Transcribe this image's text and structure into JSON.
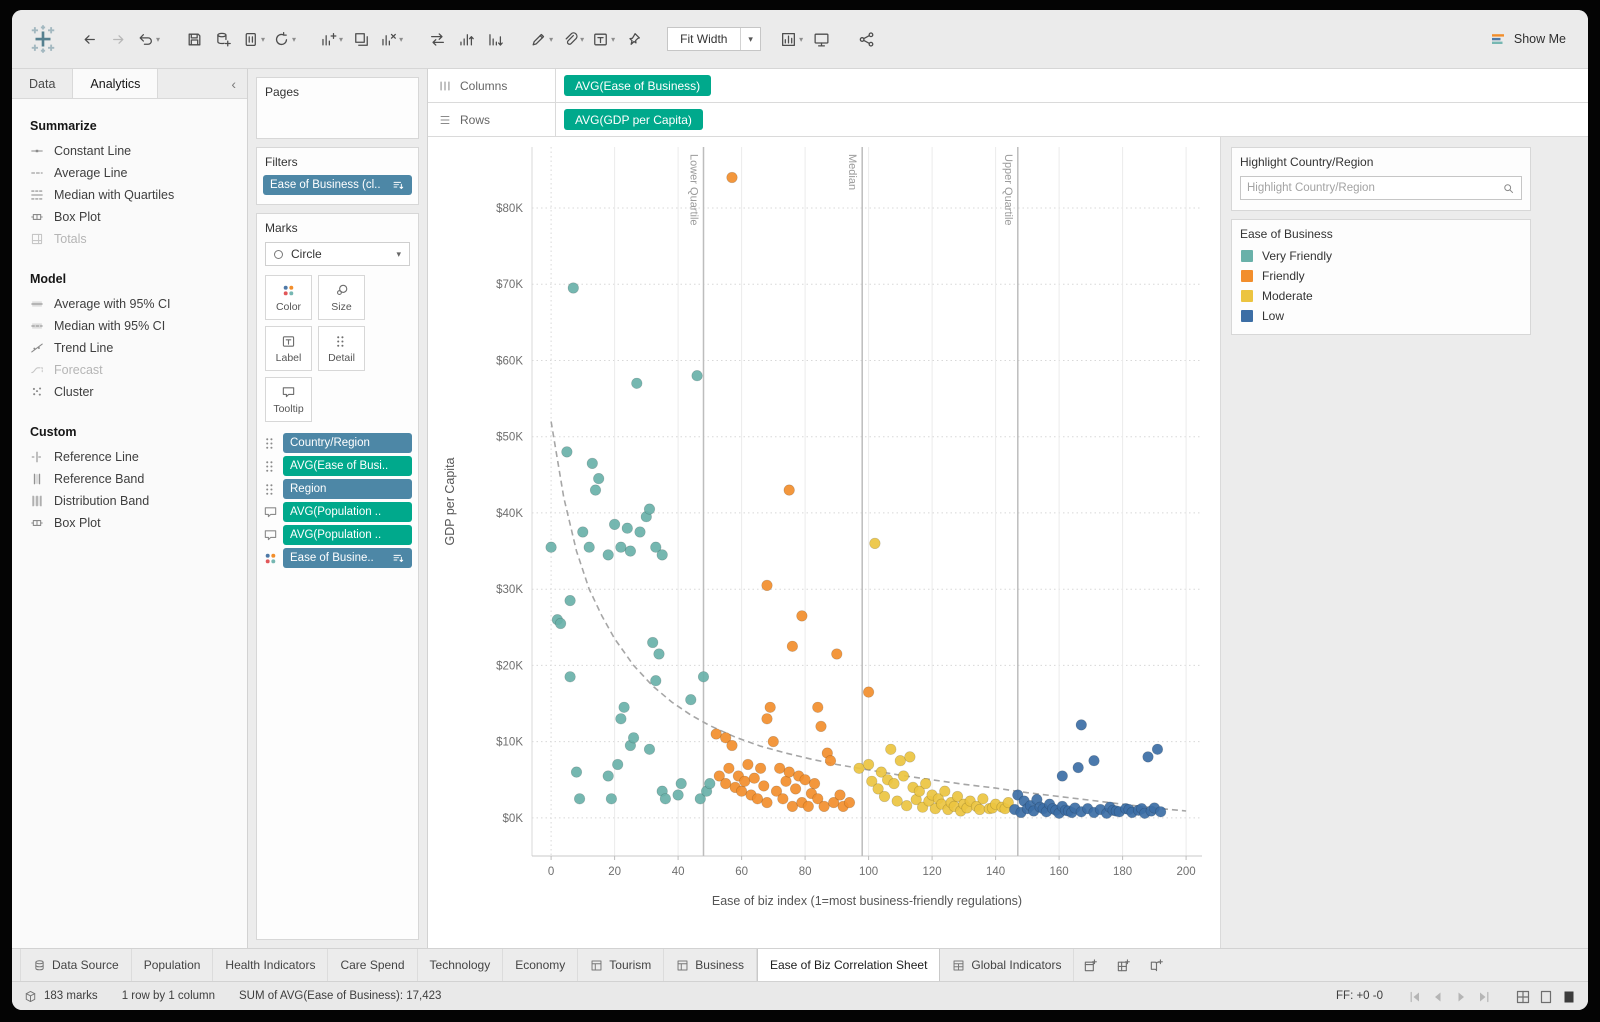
{
  "toolbar": {
    "fit_width": "Fit Width",
    "show_me": "Show Me",
    "groups_a": [
      [
        {
          "name": "back"
        },
        {
          "name": "forward",
          "disabled": true
        },
        {
          "name": "undo",
          "caret": true
        }
      ],
      [
        {
          "name": "save"
        },
        {
          "name": "add-datasource"
        },
        {
          "name": "pause-updates",
          "caret": true
        },
        {
          "name": "refresh",
          "caret": true
        }
      ],
      [
        {
          "name": "new-worksheet",
          "caret": true
        },
        {
          "name": "duplicate"
        },
        {
          "name": "clear-sheet",
          "caret": true
        }
      ],
      [
        {
          "name": "swap"
        },
        {
          "name": "sort-asc"
        },
        {
          "name": "sort-desc"
        }
      ],
      [
        {
          "name": "highlight",
          "caret": true
        },
        {
          "name": "attach",
          "caret": true
        },
        {
          "name": "label",
          "caret": true
        },
        {
          "name": "pin"
        }
      ]
    ],
    "groups_b": [
      [
        {
          "name": "chart-view",
          "caret": true
        },
        {
          "name": "presentation"
        }
      ],
      [
        {
          "name": "share"
        }
      ]
    ]
  },
  "left_panel": {
    "tabs": [
      {
        "label": "Data",
        "active": false
      },
      {
        "label": "Analytics",
        "active": true
      }
    ],
    "sections": [
      {
        "title": "Summarize",
        "items": [
          {
            "label": "Constant Line",
            "icon": "constant-line"
          },
          {
            "label": "Average Line",
            "icon": "average-line"
          },
          {
            "label": "Median with Quartiles",
            "icon": "median-quartiles"
          },
          {
            "label": "Box Plot",
            "icon": "box-plot"
          },
          {
            "label": "Totals",
            "icon": "totals",
            "disabled": true
          }
        ]
      },
      {
        "title": "Model",
        "items": [
          {
            "label": "Average with 95% CI",
            "icon": "average-ci"
          },
          {
            "label": "Median with 95% CI",
            "icon": "median-ci"
          },
          {
            "label": "Trend Line",
            "icon": "trend-line"
          },
          {
            "label": "Forecast",
            "icon": "forecast",
            "disabled": true
          },
          {
            "label": "Cluster",
            "icon": "cluster"
          }
        ]
      },
      {
        "title": "Custom",
        "items": [
          {
            "label": "Reference Line",
            "icon": "reference-line"
          },
          {
            "label": "Reference Band",
            "icon": "reference-band"
          },
          {
            "label": "Distribution Band",
            "icon": "distribution-band"
          },
          {
            "label": "Box Plot",
            "icon": "box-plot"
          }
        ]
      }
    ]
  },
  "cards": {
    "pages": {
      "title": "Pages"
    },
    "filters": {
      "title": "Filters",
      "pills": [
        {
          "label": "Ease of Business (cl..",
          "color": "blue",
          "trailing_icon": "sort"
        }
      ]
    },
    "marks": {
      "title": "Marks",
      "mark_type": "Circle",
      "buttons": [
        {
          "label": "Color",
          "icon": "color"
        },
        {
          "label": "Size",
          "icon": "size"
        },
        {
          "label": "Label",
          "icon": "label"
        },
        {
          "label": "Detail",
          "icon": "detail"
        },
        {
          "label": "Tooltip",
          "icon": "tooltip"
        }
      ],
      "pills": [
        {
          "label": "Country/Region",
          "color": "blue",
          "icon": "detail"
        },
        {
          "label": "AVG(Ease of Busi..",
          "color": "green",
          "icon": "detail"
        },
        {
          "label": "Region",
          "color": "blue",
          "icon": "detail"
        },
        {
          "label": "AVG(Population ..",
          "color": "green",
          "icon": "tooltip"
        },
        {
          "label": "AVG(Population ..",
          "color": "green",
          "icon": "tooltip"
        },
        {
          "label": "Ease of Busine..",
          "color": "blue",
          "icon": "color",
          "trailing_icon": "sort"
        }
      ]
    }
  },
  "shelves": {
    "columns": {
      "label": "Columns",
      "pills": [
        {
          "label": "AVG(Ease of Business)",
          "color": "green"
        }
      ]
    },
    "rows": {
      "label": "Rows",
      "pills": [
        {
          "label": "AVG(GDP per Capita)",
          "color": "green"
        }
      ]
    }
  },
  "right_panel": {
    "highlight": {
      "title": "Highlight Country/Region",
      "placeholder": "Highlight Country/Region"
    },
    "legend": {
      "title": "Ease of Business",
      "items": [
        {
          "label": "Very Friendly",
          "color": "#69b1a9"
        },
        {
          "label": "Friendly",
          "color": "#f28e2c"
        },
        {
          "label": "Moderate",
          "color": "#ecc440"
        },
        {
          "label": "Low",
          "color": "#3c6ea5"
        }
      ]
    }
  },
  "chart_data": {
    "type": "scatter",
    "xlabel": "Ease of biz index (1=most business-friendly regulations)",
    "ylabel": "GDP per Capita",
    "xlim": [
      -6,
      205
    ],
    "ylim": [
      -5,
      88
    ],
    "x_ticks": [
      0,
      20,
      40,
      60,
      80,
      100,
      120,
      140,
      160,
      180,
      200
    ],
    "y_ticks": [
      0,
      10,
      20,
      30,
      40,
      50,
      60,
      70,
      80
    ],
    "y_tick_prefix": "$",
    "y_tick_suffix": "K",
    "grid": true,
    "legend_position": "right",
    "reference_lines": [
      {
        "x": 48,
        "label": "Lower Quartile"
      },
      {
        "x": 98,
        "label": "Median"
      },
      {
        "x": 147,
        "label": "Upper Quartile"
      }
    ],
    "trend_curve": [
      [
        0,
        52
      ],
      [
        4,
        42
      ],
      [
        8,
        35
      ],
      [
        12,
        30
      ],
      [
        16,
        26.5
      ],
      [
        20,
        23.5
      ],
      [
        26,
        20
      ],
      [
        32,
        17.3
      ],
      [
        38,
        15.2
      ],
      [
        44,
        13.5
      ],
      [
        50,
        12.1
      ],
      [
        58,
        10.6
      ],
      [
        66,
        9.4
      ],
      [
        74,
        8.5
      ],
      [
        82,
        7.7
      ],
      [
        90,
        7.0
      ],
      [
        100,
        6.3
      ],
      [
        110,
        5.6
      ],
      [
        120,
        5.0
      ],
      [
        130,
        4.4
      ],
      [
        140,
        3.9
      ],
      [
        150,
        3.3
      ],
      [
        160,
        2.8
      ],
      [
        170,
        2.3
      ],
      [
        180,
        1.8
      ],
      [
        190,
        1.3
      ],
      [
        200,
        0.9
      ]
    ],
    "series": [
      {
        "name": "Very Friendly",
        "color": "#69b1a9",
        "points": [
          [
            0,
            35.5
          ],
          [
            2,
            26
          ],
          [
            3,
            25.5
          ],
          [
            5,
            48
          ],
          [
            6,
            28.5
          ],
          [
            6,
            18.5
          ],
          [
            7,
            69.5
          ],
          [
            8,
            6
          ],
          [
            9,
            2.5
          ],
          [
            10,
            37.5
          ],
          [
            12,
            35.5
          ],
          [
            13,
            46.5
          ],
          [
            14,
            43
          ],
          [
            15,
            44.5
          ],
          [
            18,
            34.5
          ],
          [
            18,
            5.5
          ],
          [
            19,
            2.5
          ],
          [
            20,
            38.5
          ],
          [
            21,
            7
          ],
          [
            22,
            35.5
          ],
          [
            22,
            13
          ],
          [
            23,
            14.5
          ],
          [
            24,
            38
          ],
          [
            25,
            35
          ],
          [
            25,
            9.5
          ],
          [
            26,
            10.5
          ],
          [
            27,
            57
          ],
          [
            28,
            37.5
          ],
          [
            30,
            39.5
          ],
          [
            31,
            40.5
          ],
          [
            31,
            9
          ],
          [
            32,
            23
          ],
          [
            33,
            35.5
          ],
          [
            33,
            18
          ],
          [
            34,
            21.5
          ],
          [
            35,
            34.5
          ],
          [
            35,
            3.5
          ],
          [
            36,
            2.5
          ],
          [
            40,
            3
          ],
          [
            41,
            4.5
          ],
          [
            44,
            15.5
          ],
          [
            46,
            58
          ],
          [
            47,
            2.5
          ],
          [
            48,
            18.5
          ],
          [
            49,
            3.5
          ],
          [
            50,
            4.5
          ]
        ]
      },
      {
        "name": "Friendly",
        "color": "#f28e2c",
        "points": [
          [
            52,
            11
          ],
          [
            53,
            5.5
          ],
          [
            55,
            10.5
          ],
          [
            55,
            4.5
          ],
          [
            56,
            6.5
          ],
          [
            57,
            84
          ],
          [
            57,
            9.5
          ],
          [
            58,
            4
          ],
          [
            59,
            5.5
          ],
          [
            60,
            3.5
          ],
          [
            61,
            4.8
          ],
          [
            62,
            7
          ],
          [
            63,
            3
          ],
          [
            64,
            5.2
          ],
          [
            65,
            2.5
          ],
          [
            66,
            6.5
          ],
          [
            67,
            4.2
          ],
          [
            68,
            30.5
          ],
          [
            68,
            13
          ],
          [
            68,
            2
          ],
          [
            69,
            14.5
          ],
          [
            70,
            10
          ],
          [
            71,
            3.5
          ],
          [
            72,
            6.5
          ],
          [
            73,
            2.5
          ],
          [
            74,
            4.8
          ],
          [
            75,
            43
          ],
          [
            75,
            6
          ],
          [
            76,
            22.5
          ],
          [
            76,
            1.5
          ],
          [
            77,
            3.8
          ],
          [
            78,
            5.5
          ],
          [
            79,
            26.5
          ],
          [
            79,
            2
          ],
          [
            80,
            5
          ],
          [
            81,
            1.5
          ],
          [
            82,
            3.2
          ],
          [
            83,
            4.5
          ],
          [
            84,
            14.5
          ],
          [
            84,
            2.5
          ],
          [
            85,
            12
          ],
          [
            86,
            1.5
          ],
          [
            87,
            8.5
          ],
          [
            88,
            7.5
          ],
          [
            89,
            2
          ],
          [
            90,
            21.5
          ],
          [
            91,
            3
          ],
          [
            92,
            1.5
          ],
          [
            94,
            2
          ],
          [
            100,
            16.5
          ]
        ]
      },
      {
        "name": "Moderate",
        "color": "#ecc440",
        "points": [
          [
            97,
            6.5
          ],
          [
            100,
            7
          ],
          [
            101,
            4.8
          ],
          [
            102,
            36
          ],
          [
            103,
            3.8
          ],
          [
            104,
            6
          ],
          [
            105,
            2.8
          ],
          [
            106,
            5
          ],
          [
            107,
            9
          ],
          [
            108,
            4.5
          ],
          [
            109,
            2.2
          ],
          [
            110,
            7.5
          ],
          [
            111,
            5.5
          ],
          [
            112,
            1.6
          ],
          [
            113,
            8
          ],
          [
            114,
            4
          ],
          [
            115,
            2.4
          ],
          [
            116,
            3.5
          ],
          [
            117,
            1.4
          ],
          [
            118,
            4.5
          ],
          [
            119,
            2.2
          ],
          [
            120,
            3
          ],
          [
            121,
            1.2
          ],
          [
            122,
            2.5
          ],
          [
            123,
            1.8
          ],
          [
            124,
            3.5
          ],
          [
            125,
            1.1
          ],
          [
            126,
            2
          ],
          [
            127,
            1.5
          ],
          [
            128,
            2.8
          ],
          [
            129,
            0.9
          ],
          [
            130,
            1.8
          ],
          [
            131,
            1.3
          ],
          [
            132,
            2.2
          ],
          [
            134,
            1.5
          ],
          [
            135,
            1.1
          ],
          [
            136,
            2.5
          ],
          [
            138,
            1.2
          ],
          [
            139,
            1.3
          ],
          [
            140,
            1.8
          ],
          [
            142,
            1.4
          ],
          [
            143,
            1.2
          ],
          [
            144,
            2
          ]
        ]
      },
      {
        "name": "Low",
        "color": "#3c6ea5",
        "points": [
          [
            146,
            1.1
          ],
          [
            147,
            3
          ],
          [
            148,
            0.7
          ],
          [
            149,
            2.2
          ],
          [
            150,
            1.2
          ],
          [
            151,
            1.6
          ],
          [
            152,
            0.9
          ],
          [
            153,
            2.4
          ],
          [
            154,
            1.4
          ],
          [
            155,
            1.2
          ],
          [
            156,
            0.8
          ],
          [
            157,
            1.8
          ],
          [
            158,
            1.2
          ],
          [
            159,
            1
          ],
          [
            160,
            0.6
          ],
          [
            161,
            5.5
          ],
          [
            161,
            1.5
          ],
          [
            162,
            1
          ],
          [
            163,
            0.9
          ],
          [
            164,
            0.7
          ],
          [
            165,
            1.3
          ],
          [
            166,
            6.6
          ],
          [
            167,
            12.2
          ],
          [
            167,
            0.8
          ],
          [
            169,
            1.2
          ],
          [
            171,
            7.5
          ],
          [
            171,
            0.7
          ],
          [
            173,
            1.1
          ],
          [
            175,
            0.6
          ],
          [
            176,
            1.4
          ],
          [
            177,
            1
          ],
          [
            178,
            0.9
          ],
          [
            179,
            0.8
          ],
          [
            181,
            1.2
          ],
          [
            182,
            1.1
          ],
          [
            183,
            0.7
          ],
          [
            185,
            1
          ],
          [
            186,
            1.2
          ],
          [
            187,
            0.6
          ],
          [
            188,
            8
          ],
          [
            189,
            0.9
          ],
          [
            190,
            1.3
          ],
          [
            191,
            9
          ],
          [
            192,
            0.8
          ]
        ]
      }
    ]
  },
  "sheet_tabs": {
    "tabs": [
      {
        "label": "Data Source",
        "icon": "datasource"
      },
      {
        "label": "Population"
      },
      {
        "label": "Health Indicators"
      },
      {
        "label": "Care Spend"
      },
      {
        "label": "Technology"
      },
      {
        "label": "Economy"
      },
      {
        "label": "Tourism",
        "icon": "sheet-grid"
      },
      {
        "label": "Business",
        "icon": "sheet-grid"
      },
      {
        "label": "Ease of Biz Correlation Sheet",
        "active": true
      },
      {
        "label": "Global Indicators",
        "icon": "sheet-book"
      }
    ],
    "new_buttons": [
      {
        "name": "new-worksheet-tab"
      },
      {
        "name": "new-dashboard"
      },
      {
        "name": "new-story"
      }
    ]
  },
  "status_bar": {
    "marks": "183 marks",
    "size": "1 row by 1 column",
    "aggregate": "SUM of AVG(Ease of Business): 17,423",
    "ff": "FF: +0 -0",
    "player": [
      "skip-start",
      "step-back",
      "step-fwd",
      "skip-end"
    ],
    "views": [
      "grid-view",
      "page-view",
      "filled-view"
    ]
  }
}
